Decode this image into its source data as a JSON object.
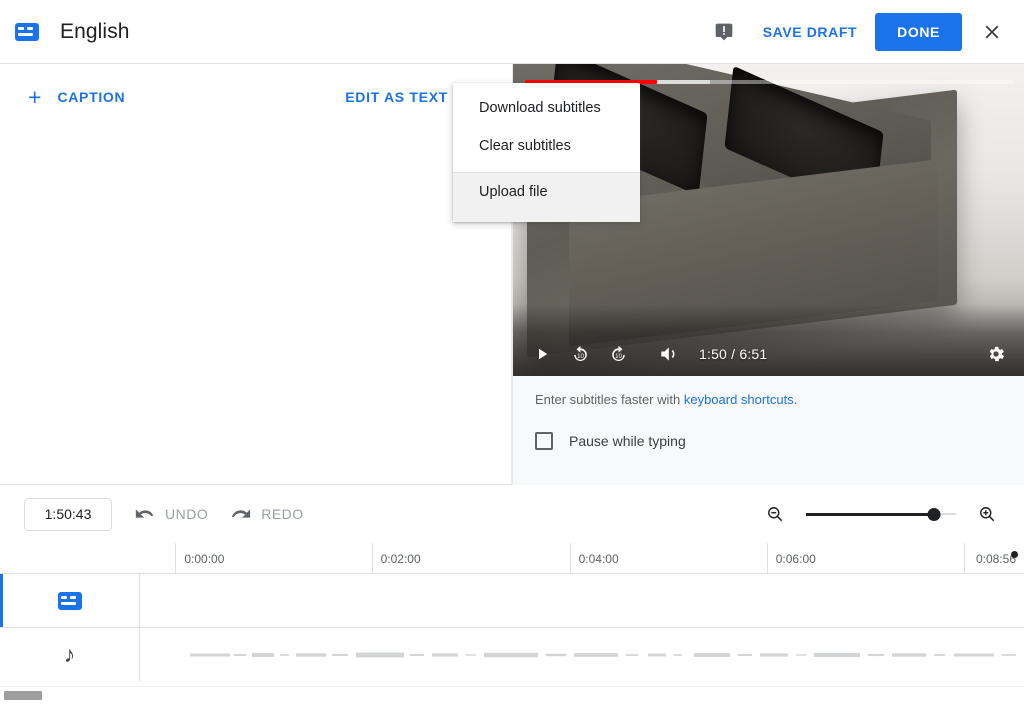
{
  "header": {
    "cc_icon": "closed-caption-icon",
    "title": "English",
    "feedback_icon": "feedback-icon",
    "save_draft_label": "SAVE DRAFT",
    "done_label": "DONE",
    "close_icon": "close-icon"
  },
  "subtoolbar": {
    "plus": "+",
    "add_caption_label": "CAPTION",
    "edit_as_text_label": "EDIT AS TEXT"
  },
  "menu": {
    "items": [
      {
        "label": "Download subtitles",
        "hovered": false
      },
      {
        "label": "Clear subtitles",
        "hovered": false
      },
      {
        "label": "Upload file",
        "hovered": true
      }
    ]
  },
  "player": {
    "play_icon": "play-icon",
    "rewind_icon": "replay-10-icon",
    "forward_icon": "forward-10-icon",
    "volume_icon": "volume-icon",
    "settings_icon": "settings-gear-icon",
    "current_time": "1:50",
    "duration": "6:51",
    "time_display": "1:50 / 6:51",
    "progress_percent": 27,
    "buffered_percent": 38,
    "accent_color": "#ff0000"
  },
  "hints": {
    "prefix": "Enter subtitles faster with ",
    "link_label": "keyboard shortcuts",
    "suffix": ".",
    "pause_while_typing_label": "Pause while typing",
    "pause_while_typing_checked": false
  },
  "timeline_toolbar": {
    "timecode_value": "1:50:43",
    "undo_label": "UNDO",
    "redo_label": "REDO",
    "zoom_out_icon": "zoom-out-icon",
    "zoom_in_icon": "zoom-in-icon",
    "zoom_level_percent": 85
  },
  "ruler": {
    "ticks": [
      {
        "label": "0:00:00",
        "left_percent": 4
      },
      {
        "label": "0:02:00",
        "left_percent": 26.2
      },
      {
        "label": "0:04:00",
        "left_percent": 48.6
      },
      {
        "label": "0:06:00",
        "left_percent": 70.9
      },
      {
        "label": "0:08:56",
        "left_percent": 93.2
      }
    ],
    "end_marker": "playhead-end-dot"
  },
  "tracks": [
    {
      "icon": "closed-caption-icon",
      "name": "subtitle-track",
      "active": true,
      "has_waveform": false
    },
    {
      "icon": "music-note-icon",
      "name": "audio-track",
      "active": false,
      "has_waveform": true
    }
  ],
  "colors": {
    "accent_blue": "#1a73e8",
    "progress_red": "#ff0000",
    "text_primary": "#202124",
    "text_secondary": "#5f6368",
    "disabled_gray": "#9aa0a6",
    "border": "#e0e0e0"
  },
  "scrollbar": {
    "thumb_name": "horizontal-scrollbar-thumb"
  }
}
